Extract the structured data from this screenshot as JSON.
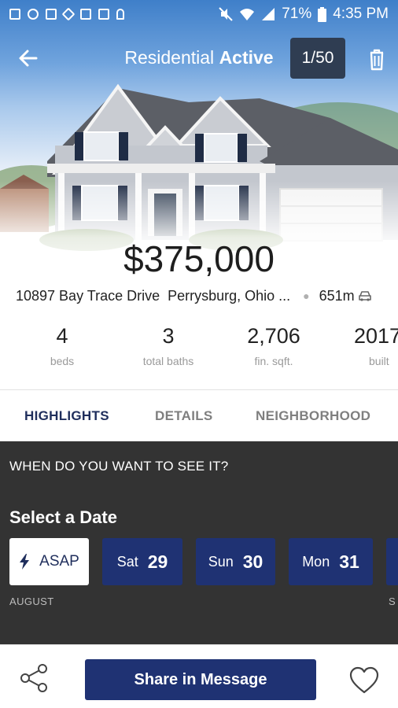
{
  "status_bar": {
    "battery": "71%",
    "time": "4:35 PM",
    "icons": [
      "image-icon",
      "shield-icon",
      "camera-icon",
      "dropbox-icon",
      "square-icon",
      "rx-icon",
      "person-icon",
      "mute-icon",
      "wifi-icon",
      "signal-icon",
      "battery-icon"
    ]
  },
  "header": {
    "title_prefix": "Residential",
    "title_status": "Active",
    "photo_counter": "1/50",
    "icons": {
      "back": "back-arrow-icon",
      "delete": "trash-icon"
    }
  },
  "listing": {
    "price": "$375,000",
    "street": "10897 Bay Trace Drive",
    "city": "Perrysburg, Ohio ...",
    "distance": "651m",
    "distance_icon": "car-icon"
  },
  "stats": [
    {
      "value": "4",
      "label": "beds"
    },
    {
      "value": "3",
      "label": "total baths"
    },
    {
      "value": "2,706",
      "label": "fin. sqft."
    },
    {
      "value": "2017",
      "label": "built"
    }
  ],
  "tabs": [
    {
      "label": "HIGHLIGHTS",
      "active": true
    },
    {
      "label": "DETAILS",
      "active": false
    },
    {
      "label": "NEIGHBORHOOD",
      "active": false
    }
  ],
  "schedule": {
    "question": "WHEN DO YOU WANT TO SEE IT?",
    "heading": "Select a Date",
    "asap_label": "ASAP",
    "asap_icon": "lightning-icon",
    "dates": [
      {
        "dow": "Sat",
        "day": "29"
      },
      {
        "dow": "Sun",
        "day": "30"
      },
      {
        "dow": "Mon",
        "day": "31"
      }
    ],
    "month": "AUGUST",
    "next_month_partial": "S"
  },
  "footer": {
    "share_button": "Share in Message",
    "icons": {
      "share": "share-icon",
      "favorite": "heart-icon"
    }
  },
  "colors": {
    "primary": "#1f3273",
    "panel": "#333333",
    "active_tab": "#1f2e5c",
    "counter_badge": "#2f3d52"
  }
}
